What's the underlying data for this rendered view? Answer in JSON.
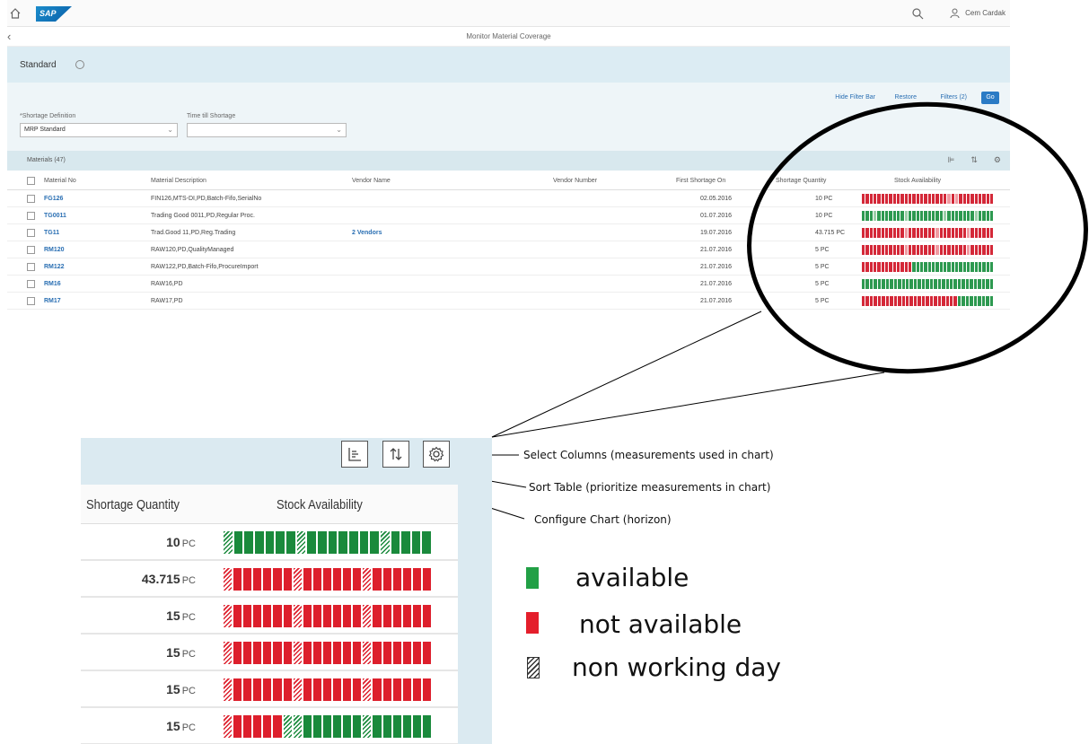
{
  "app": {
    "user": "Cem Cardak",
    "page_title": "Monitor Material Coverage",
    "variant": "Standard"
  },
  "filter_bar": {
    "hide_label": "Hide Filter Bar",
    "restore_label": "Restore",
    "filters_label": "Filters (2)",
    "go_label": "Go",
    "shortage_definition_label": "*Shortage Definition",
    "shortage_definition_value": "MRP Standard",
    "time_till_shortage_label": "Time till Shortage",
    "time_till_shortage_value": ""
  },
  "table": {
    "title": "Materials (47)",
    "columns": [
      "Material No",
      "Material Description",
      "Vendor Name",
      "Vendor Number",
      "First Shortage On",
      "Shortage Quantity",
      "Stock Availability"
    ],
    "rows": [
      {
        "no": "FG126",
        "desc": "FIN126,MTS-DI,PD,Batch-Fifo,SerialNo",
        "vendor": "",
        "date": "02.05.2016",
        "qty": "10 PC",
        "bars": "rrrrrrrrrrrrrrrrrrrrrrhrhrrrrrrrrr"
      },
      {
        "no": "TG0011",
        "desc": "Trading Good 0011,PD,Regular Proc.",
        "vendor": "",
        "date": "01.07.2016",
        "qty": "10 PC",
        "bars": "ggghggggggghggggggggghggggggghgggg"
      },
      {
        "no": "TG11",
        "desc": "Trad.Good 11,PD,Reg.Trading",
        "vendor": "2 Vendors",
        "date": "19.07.2016",
        "qty": "43.715 PC",
        "bars": "rrrrrrrrrrrhrrrrrrrhrrrrrrrhrrrrrr"
      },
      {
        "no": "RM120",
        "desc": "RAW120,PD,QualityManaged",
        "vendor": "",
        "date": "21.07.2016",
        "qty": "5 PC",
        "bars": "rrrrrrrrrrrhrrrrrrrhrrrrrrrhrrrrrr"
      },
      {
        "no": "RM122",
        "desc": "RAW122,PD,Batch-Fifo,ProcureImport",
        "vendor": "",
        "date": "21.07.2016",
        "qty": "5 PC",
        "bars": "rrrrrrrrrrrrrggggggggggggggggggggg"
      },
      {
        "no": "RM16",
        "desc": "RAW16,PD",
        "vendor": "",
        "date": "21.07.2016",
        "qty": "5 PC",
        "bars": "ggggggggggggggggggggggggggggggggg"
      },
      {
        "no": "RM17",
        "desc": "RAW17,PD",
        "vendor": "",
        "date": "21.07.2016",
        "qty": "5 PC",
        "bars": "rrrrrrrrrrrrrrrrrrrrrrrrggggggggg"
      }
    ]
  },
  "zoom": {
    "col_qty": "Shortage Quantity",
    "col_stock": "Stock Availability",
    "rows": [
      {
        "qty": "10",
        "unit": "PC",
        "bars": "hgggggghggggggghgggg"
      },
      {
        "qty": "43.715",
        "unit": "PC",
        "bars": "hrrrrrrhrrrrrrhrrrrrr"
      },
      {
        "qty": "15",
        "unit": "PC",
        "bars": "hrrrrrrhrrrrrrhrrrrrr"
      },
      {
        "qty": "15",
        "unit": "PC",
        "bars": "hrrrrrrhrrrrrrhrrrrrr"
      },
      {
        "qty": "15",
        "unit": "PC",
        "bars": "hrrrrrrhrrrrrrhrrrrrr"
      },
      {
        "qty": "15",
        "unit": "PC",
        "bars": "hrrrrrhhgggggghgggggg"
      }
    ]
  },
  "annotations": {
    "select_columns": "Select Columns (measurements used in chart)",
    "sort_table": "Sort Table (prioritize measurements in chart)",
    "configure_chart": "Configure Chart (horizon)"
  },
  "legend": {
    "available": "available",
    "not_available": "not available",
    "non_working_day": "non working day",
    "available_color": "#1a8a3c",
    "not_available_color": "#dd1f2c"
  }
}
